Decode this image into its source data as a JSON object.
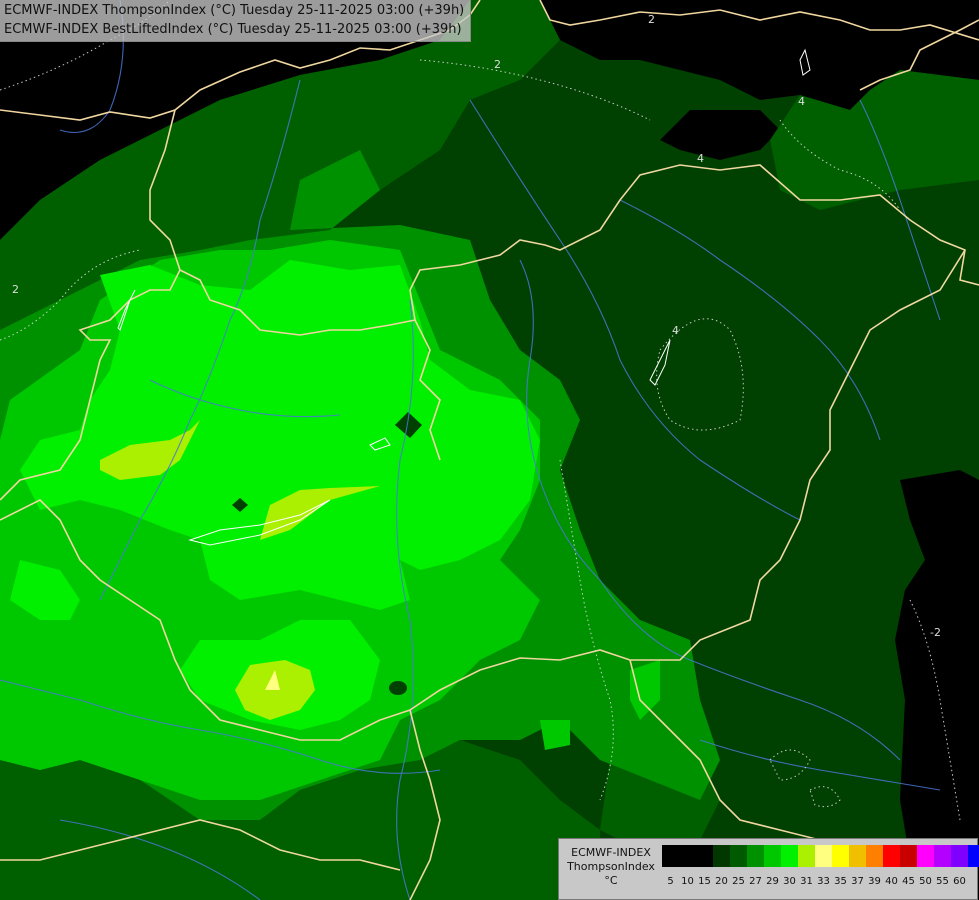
{
  "title": {
    "line1": "ECMWF-INDEX ThompsonIndex (°C) Tuesday 25-11-2025 03:00 (+39h)",
    "line2": "ECMWF-INDEX BestLiftedIndex (°C) Tuesday 25-11-2025 03:00 (+39h)"
  },
  "legend": {
    "model": "ECMWF-INDEX",
    "parameter": "ThompsonIndex",
    "unit": "°C",
    "classes": [
      {
        "value": "5",
        "color": "#000000"
      },
      {
        "value": "10",
        "color": "#000000"
      },
      {
        "value": "15",
        "color": "#000000"
      },
      {
        "value": "20",
        "color": "#003800"
      },
      {
        "value": "25",
        "color": "#005a00"
      },
      {
        "value": "27",
        "color": "#009100"
      },
      {
        "value": "29",
        "color": "#00c800"
      },
      {
        "value": "30",
        "color": "#00f000"
      },
      {
        "value": "31",
        "color": "#aaf000"
      },
      {
        "value": "33",
        "color": "#ffff80"
      },
      {
        "value": "35",
        "color": "#ffff00"
      },
      {
        "value": "37",
        "color": "#f0c000"
      },
      {
        "value": "39",
        "color": "#ff7f00"
      },
      {
        "value": "40",
        "color": "#ff0000"
      },
      {
        "value": "45",
        "color": "#c80000"
      },
      {
        "value": "50",
        "color": "#ff00ff"
      },
      {
        "value": "55",
        "color": "#b400ff"
      },
      {
        "value": "60",
        "color": "#7f00ff"
      },
      {
        "value": "",
        "color": "#0000ff"
      }
    ]
  },
  "contour_labels": [
    "2",
    "2",
    "2",
    "4",
    "4",
    "4",
    "-2"
  ],
  "colors": {
    "border": "#f0d7a0",
    "river": "#4a78d8",
    "contour": "#dcdcdc"
  }
}
